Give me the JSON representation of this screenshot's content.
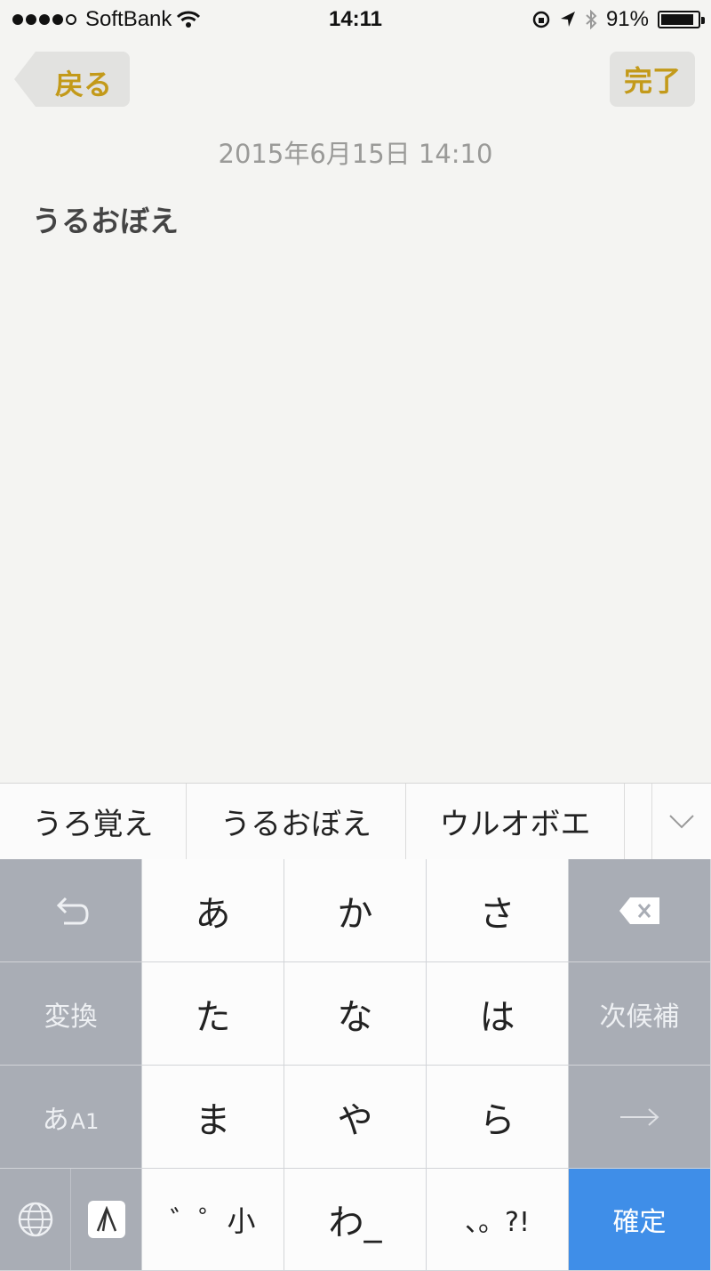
{
  "status_bar": {
    "carrier": "SoftBank",
    "time": "14:11",
    "battery_percent": "91%",
    "battery_level": 0.91,
    "signal_filled": 4,
    "signal_total": 5
  },
  "nav": {
    "back_label": "戻る",
    "done_label": "完了",
    "accent_color": "#c39a1a"
  },
  "note": {
    "date": "2015年6月15日 14:10",
    "body": "うるおぼえ"
  },
  "candidates": [
    "うろ覚え",
    "うるおぼえ",
    "ウルオボエ",
    "("
  ],
  "keyboard": {
    "undo_icon": "undo-icon",
    "keys_row1": [
      "あ",
      "か",
      "さ"
    ],
    "keys_row2": [
      "た",
      "な",
      "は"
    ],
    "keys_row3": [
      "ま",
      "や",
      "ら"
    ],
    "row4_key1": "゛゜小",
    "row4_key2": "わ_",
    "row4_key3": "、。?!",
    "henkan": "変換",
    "mode": "あ",
    "mode_small": "A1",
    "next_candidate": "次候補",
    "confirm": "確定",
    "confirm_color": "#3f8ee8"
  }
}
